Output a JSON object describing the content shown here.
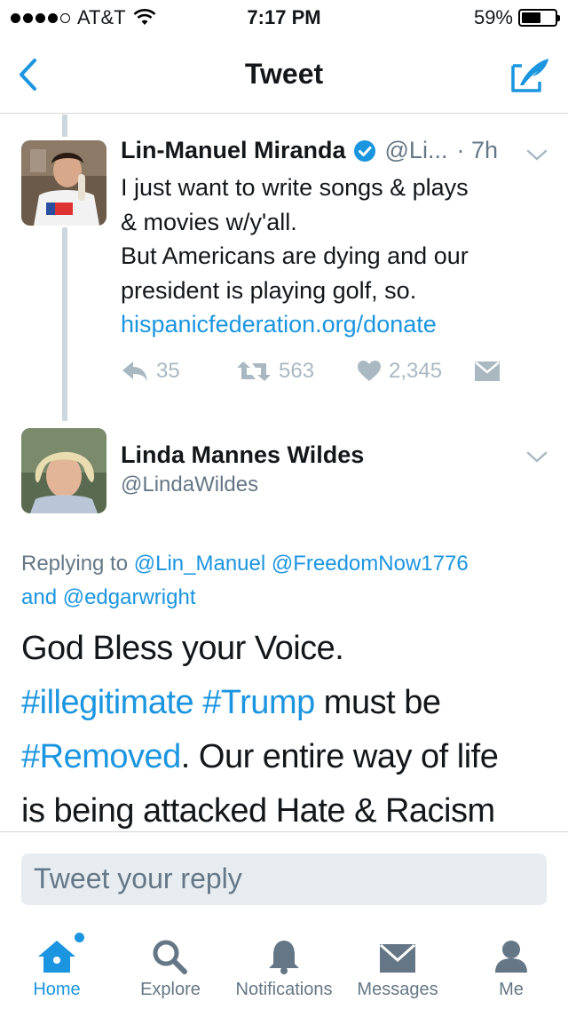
{
  "status_bar": {
    "carrier": "AT&T",
    "time": "7:17 PM",
    "battery_percent": "59%",
    "battery_level": 0.59
  },
  "nav": {
    "title": "Tweet",
    "back_icon": "chevron-left-icon",
    "compose_icon": "compose-tweet-icon"
  },
  "tweet1": {
    "name": "Lin-Manuel Miranda",
    "handle": "@Li...",
    "time": "· 7h",
    "text_lines": [
      "I just want to write songs & plays",
      "& movies w/y'all.",
      "But Americans are dying and our",
      "president is playing golf, so."
    ],
    "link": "hispanicfederation.org/donate",
    "replies": "35",
    "retweets": "563",
    "likes": "2,345"
  },
  "tweet2": {
    "name": "Linda Mannes Wildes",
    "handle": "@LindaWildes",
    "replying_label": "Replying to",
    "replying_to_1": "@Lin_Manuel",
    "replying_to_2": "@FreedomNow1776",
    "replying_and": "and",
    "replying_to_3": "@edgarwright",
    "line1": "God Bless your Voice.",
    "hashtag1": "#illegitimate",
    "hashtag2": "#Trump",
    "line2_rest": " must be",
    "hashtag3": "#Removed",
    "line3_rest": ". Our entire way of life",
    "line4": "is being attacked Hate & Racism"
  },
  "reply_box": {
    "placeholder": "Tweet your reply"
  },
  "tabs": [
    {
      "label": "Home",
      "icon": "home-icon",
      "active": true
    },
    {
      "label": "Explore",
      "icon": "search-icon",
      "active": false
    },
    {
      "label": "Notifications",
      "icon": "bell-icon",
      "active": false
    },
    {
      "label": "Messages",
      "icon": "envelope-icon",
      "active": false
    },
    {
      "label": "Me",
      "icon": "person-icon",
      "active": false
    }
  ],
  "colors": {
    "accent": "#1b95e0",
    "muted": "#657786",
    "action_grey": "#aab8c2",
    "thread_line": "#ccd6dd",
    "reply_bg": "#e6ecf0"
  }
}
